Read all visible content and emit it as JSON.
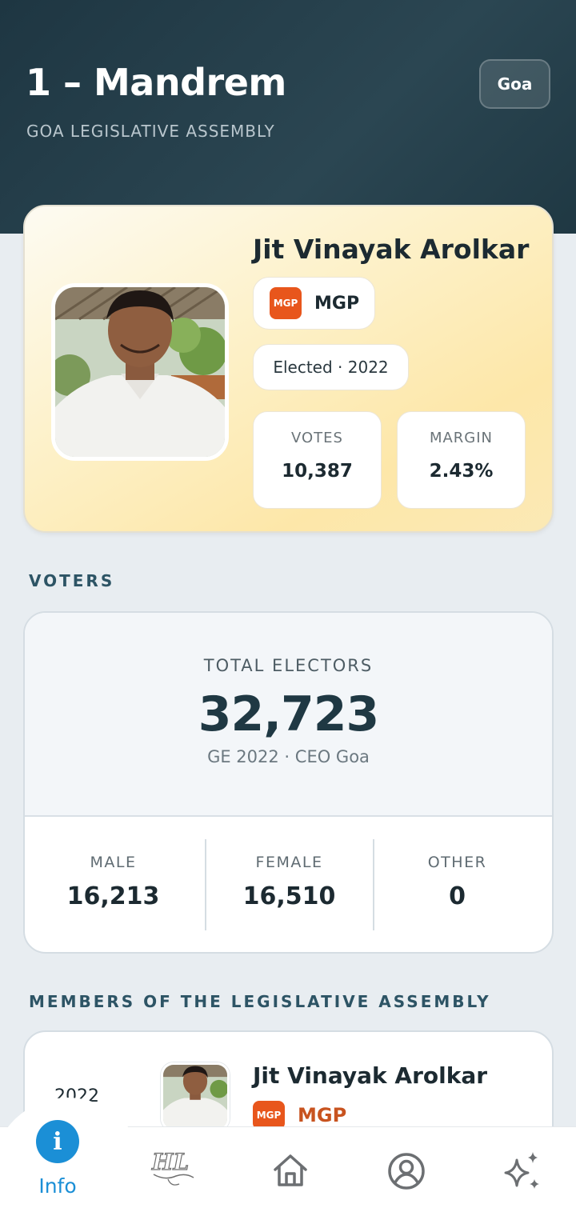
{
  "header": {
    "title": "1 – Mandrem",
    "subtitle": "GOA LEGISLATIVE ASSEMBLY",
    "state_button": "Goa"
  },
  "candidate": {
    "name": "Jit Vinayak Arolkar",
    "party_logo_text": "MGP",
    "party": "MGP",
    "status": "Elected · 2022",
    "votes_label": "VOTES",
    "votes_value": "10,387",
    "margin_label": "MARGIN",
    "margin_value": "2.43%"
  },
  "voters": {
    "section_label": "VOTERS",
    "total_label": "TOTAL ELECTORS",
    "total_value": "32,723",
    "source": "GE 2022 · CEO Goa",
    "male_label": "MALE",
    "male_value": "16,213",
    "female_label": "FEMALE",
    "female_value": "16,510",
    "other_label": "OTHER",
    "other_value": "0"
  },
  "mlas": {
    "section_label": "MEMBERS OF THE LEGISLATIVE ASSEMBLY",
    "items": [
      {
        "year": "2022",
        "name": "Jit Vinayak Arolkar",
        "party_logo_text": "MGP",
        "party": "MGP"
      }
    ]
  },
  "nav": {
    "items": [
      {
        "label": "Info",
        "icon": "info-icon",
        "active": true
      },
      {
        "label": "",
        "icon": "hl-logo-icon"
      },
      {
        "label": "",
        "icon": "home-icon"
      },
      {
        "label": "",
        "icon": "profile-icon"
      },
      {
        "label": "",
        "icon": "sparkles-icon"
      }
    ]
  },
  "colors": {
    "header_bg": "#1e3642",
    "accent_blue": "#1b8fd6",
    "party_orange": "#e8561c",
    "section_label": "#2d5465"
  }
}
